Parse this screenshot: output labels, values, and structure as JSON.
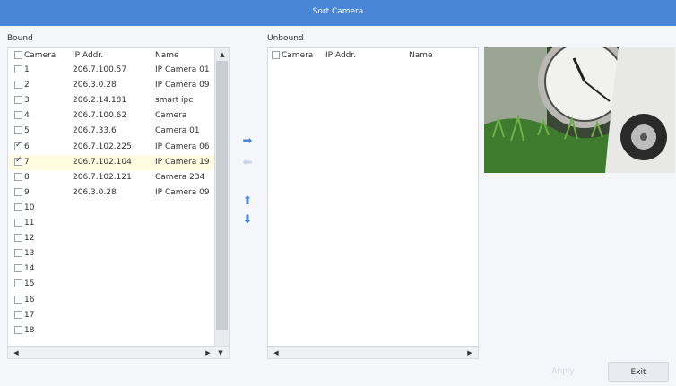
{
  "window": {
    "title": "Sort Camera"
  },
  "bound": {
    "label": "Bound",
    "columns": {
      "camera": "Camera",
      "ip": "IP Addr.",
      "name": "Name"
    },
    "rows": [
      {
        "camera": "1",
        "ip": "206.7.100.57",
        "name": "IP Camera 01",
        "checked": false
      },
      {
        "camera": "2",
        "ip": "206.3.0.28",
        "name": "IP Camera 09",
        "checked": false
      },
      {
        "camera": "3",
        "ip": "206.2.14.181",
        "name": "smart ipc",
        "checked": false
      },
      {
        "camera": "4",
        "ip": "206.7.100.62",
        "name": "Camera",
        "checked": false
      },
      {
        "camera": "5",
        "ip": "206.7.33.6",
        "name": "Camera 01",
        "checked": false
      },
      {
        "camera": "6",
        "ip": "206.7.102.225",
        "name": "IP Camera 06",
        "checked": true
      },
      {
        "camera": "7",
        "ip": "206.7.102.104",
        "name": "IP Camera 19",
        "checked": true,
        "selected": true
      },
      {
        "camera": "8",
        "ip": "206.7.102.121",
        "name": "Camera 234",
        "checked": false
      },
      {
        "camera": "9",
        "ip": "206.3.0.28",
        "name": "IP Camera 09",
        "checked": false
      },
      {
        "camera": "10",
        "ip": "",
        "name": "",
        "checked": false
      },
      {
        "camera": "11",
        "ip": "",
        "name": "",
        "checked": false
      },
      {
        "camera": "12",
        "ip": "",
        "name": "",
        "checked": false
      },
      {
        "camera": "13",
        "ip": "",
        "name": "",
        "checked": false
      },
      {
        "camera": "14",
        "ip": "",
        "name": "",
        "checked": false
      },
      {
        "camera": "15",
        "ip": "",
        "name": "",
        "checked": false
      },
      {
        "camera": "16",
        "ip": "",
        "name": "",
        "checked": false
      },
      {
        "camera": "17",
        "ip": "",
        "name": "",
        "checked": false
      },
      {
        "camera": "18",
        "ip": "",
        "name": "",
        "checked": false
      }
    ]
  },
  "unbound": {
    "label": "Unbound",
    "columns": {
      "camera": "Camera",
      "ip": "IP Addr.",
      "name": "Name"
    }
  },
  "buttons": {
    "apply": "Apply",
    "exit": "Exit"
  },
  "icons": {
    "move_right": "arrow-right-icon",
    "move_left": "arrow-left-icon",
    "move_up": "arrow-up-icon",
    "move_down": "arrow-down-icon"
  },
  "colors": {
    "title_bar": "#4a86d8",
    "accent": "#4a86d8",
    "selected_row": "#fffbe0"
  }
}
